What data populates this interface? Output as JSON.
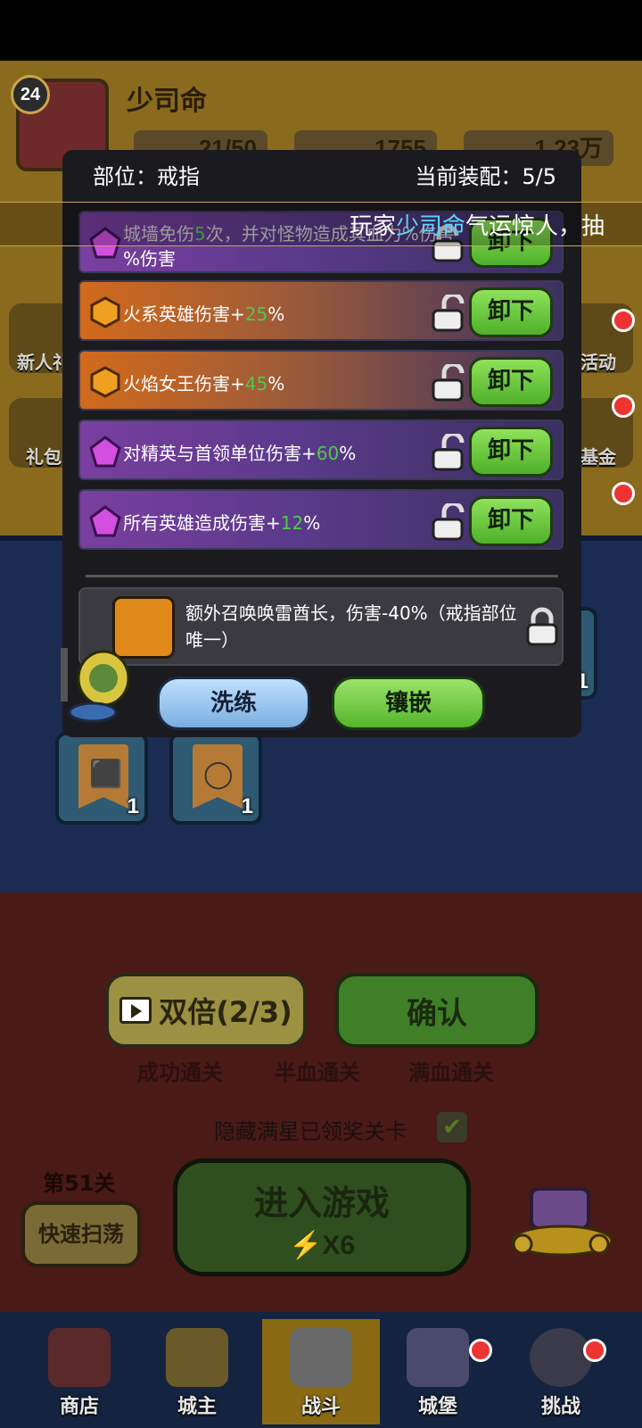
{
  "player": {
    "level": "24",
    "name": "少司命",
    "stats": [
      "21/50",
      "1755",
      "1.23万"
    ]
  },
  "side_icons_left": [
    "新人礼",
    "礼包"
  ],
  "side_icons_right": [
    "活动",
    "基金"
  ],
  "modal": {
    "slot_label": "部位：戒指",
    "equip_label": "当前装配：5/5",
    "attributes": [
      {
        "type": "purple",
        "prefix": "城墙免伤",
        "number": "5",
        "suffix": "次，并对怪物造成其血力%伤害",
        "line2": "%伤害",
        "button": "卸下"
      },
      {
        "type": "orange",
        "prefix": "火系英雄伤害+",
        "number": "25",
        "suffix": "%",
        "button": "卸下"
      },
      {
        "type": "orange",
        "prefix": "火焰女王伤害+",
        "number": "45",
        "suffix": "%",
        "button": "卸下"
      },
      {
        "type": "purple",
        "prefix": "对精英与首领单位伤害+",
        "number": "60",
        "suffix": "%",
        "button": "卸下"
      },
      {
        "type": "purple",
        "prefix": "所有英雄造成伤害+",
        "number": "12",
        "suffix": "%",
        "button": "卸下"
      }
    ],
    "special_text": "额外召唤唤雷酋长，伤害-40%（戒指部位唯一）",
    "refine_button": "洗练",
    "inlay_button": "镶嵌"
  },
  "marquee": {
    "prefix": "玩家",
    "name": "少司命",
    "suffix": "气运惊人，抽"
  },
  "reward_slots": [
    {
      "count": "1"
    },
    {
      "count": "1"
    },
    {
      "count": "1"
    }
  ],
  "actions": {
    "double_button": "双倍(2/3)",
    "confirm_button": "确认",
    "star_labels": [
      "成功通关",
      "半血通关",
      "满血通关"
    ],
    "hide_label": "隐藏满星已领奖关卡",
    "stage_label": "第51关",
    "sweep_button": "快速扫荡",
    "enter_button": "进入游戏",
    "enter_cost": "X6"
  },
  "nav": [
    {
      "label": "商店",
      "icon": "shop-icon"
    },
    {
      "label": "城主",
      "icon": "crown-icon"
    },
    {
      "label": "战斗",
      "icon": "swords-icon"
    },
    {
      "label": "城堡",
      "icon": "castle-icon"
    },
    {
      "label": "挑战",
      "icon": "bomb-icon"
    }
  ],
  "colors": {
    "accent_green": "#4ec94e",
    "highlight_cyan": "#5fd3ff",
    "button_green": "#7ccf45"
  }
}
